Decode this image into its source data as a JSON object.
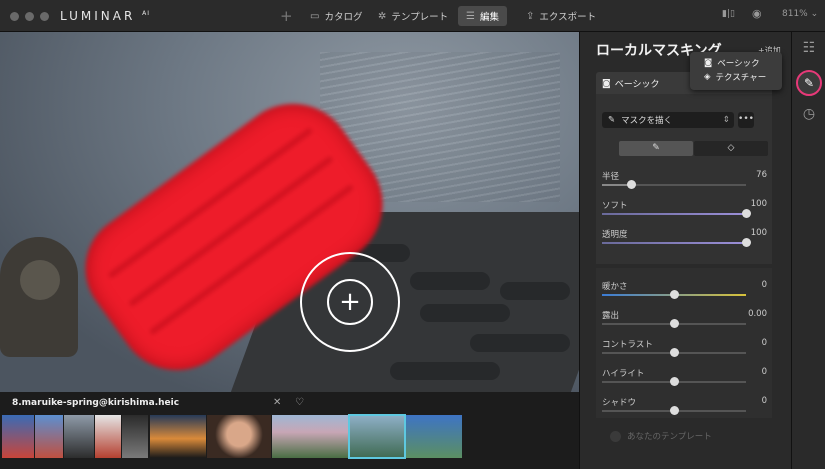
{
  "app": {
    "logo": "LUMINAR",
    "logo_sup": "AI"
  },
  "nav": {
    "add_icon": "+",
    "catalog": "カタログ",
    "templates": "テンプレート",
    "edit": "編集",
    "export": "エクスポート"
  },
  "topbar_right": {
    "zoom": "811%"
  },
  "filmstrip": {
    "file_name": "8.maruike-spring@kirishima.heic"
  },
  "panel": {
    "title": "ローカルマスキング",
    "add": "+追加",
    "tab_basic": "ベーシック",
    "dropdown": [
      "ベーシック",
      "テクスチャー"
    ],
    "brush_select": "マスクを描く",
    "more": "•••",
    "brush_sliders": [
      {
        "label": "半径",
        "value": "76",
        "fraction": 0.2
      },
      {
        "label": "ソフト",
        "value": "100",
        "fraction": 1.0
      },
      {
        "label": "透明度",
        "value": "100",
        "fraction": 1.0
      }
    ],
    "adjust_sliders": [
      {
        "label": "暖かさ",
        "value": "0",
        "fraction": 0.5
      },
      {
        "label": "露出",
        "value": "0.00",
        "fraction": 0.5
      },
      {
        "label": "コントラスト",
        "value": "0",
        "fraction": 0.5
      },
      {
        "label": "ハイライト",
        "value": "0",
        "fraction": 0.5
      },
      {
        "label": "シャドウ",
        "value": "0",
        "fraction": 0.5
      }
    ],
    "template_row": "あなたのテンプレート"
  },
  "colors": {
    "accent": "#e63978",
    "mask": "#ee1c2a",
    "selection": "#5ec8e0"
  }
}
